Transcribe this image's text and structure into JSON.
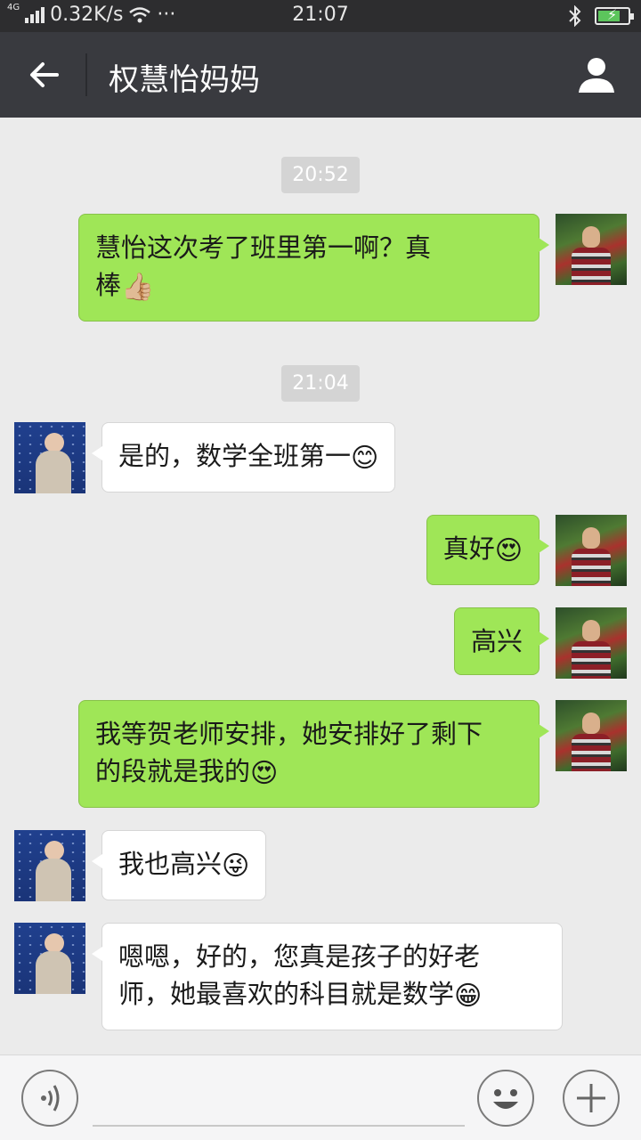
{
  "status_bar": {
    "network": "4G",
    "speed": "0.32K/s",
    "more": "···",
    "time": "21:07",
    "icons": [
      "signal-icon",
      "wifi-icon",
      "bluetooth-icon",
      "battery-charging-icon"
    ]
  },
  "header": {
    "title": "权慧怡妈妈",
    "back_icon": "back-arrow-icon",
    "profile_icon": "person-icon"
  },
  "messages": [
    {
      "type": "time",
      "text": "20:52"
    },
    {
      "type": "msg",
      "from": "me",
      "line1": "慧怡这次考了班里第一啊？真",
      "line2": "棒",
      "emoji": "👍🏼"
    },
    {
      "type": "time",
      "text": "21:04"
    },
    {
      "type": "msg",
      "from": "other",
      "text": "是的，数学全班第一",
      "emoji": "😊"
    },
    {
      "type": "msg",
      "from": "me",
      "text": "真好",
      "emoji": "😍"
    },
    {
      "type": "msg",
      "from": "me",
      "text": "高兴",
      "emoji": ""
    },
    {
      "type": "msg",
      "from": "me",
      "line1": "我等贺老师安排，她安排好了剩下",
      "line2": "的段就是我的",
      "emoji": "😍"
    },
    {
      "type": "msg",
      "from": "other",
      "text": "我也高兴",
      "emoji": "😜"
    },
    {
      "type": "msg",
      "from": "other",
      "line1": "嗯嗯，好的，您真是孩子的好老",
      "line2": "师，她最喜欢的科目就是数学",
      "emoji": "😁"
    }
  ],
  "input_bar": {
    "voice_icon": "voice-icon",
    "emoji_icon": "smiley-icon",
    "plus_icon": "plus-icon"
  },
  "colors": {
    "my_bubble": "#9fe657",
    "other_bubble": "#ffffff",
    "title_bar": "#393a3f",
    "chat_bg": "#ebebeb"
  }
}
